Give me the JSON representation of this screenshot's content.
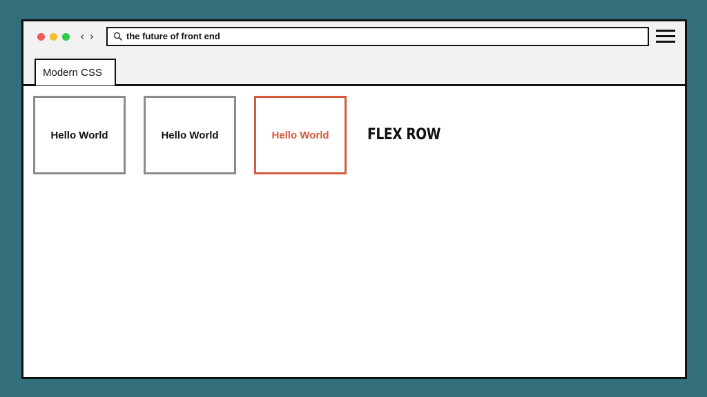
{
  "browser": {
    "address_text": "the future of front end",
    "tab_label": "Modern CSS",
    "icons": {
      "search": "search-icon",
      "menu": "hamburger-menu-icon",
      "back": "chevron-left-icon",
      "forward": "chevron-right-icon"
    }
  },
  "boxes": [
    {
      "label": "Hello World",
      "highlighted": false
    },
    {
      "label": "Hello World",
      "highlighted": false
    },
    {
      "label": "Hello World",
      "highlighted": true
    }
  ],
  "heading": "FLEX ROW",
  "colors": {
    "background": "#336e7b",
    "accent": "#d65a3a",
    "box_border": "#8a8a8a",
    "traffic_red": "#f25a5a",
    "traffic_yellow": "#f7be2c",
    "traffic_green": "#2ecb45"
  }
}
